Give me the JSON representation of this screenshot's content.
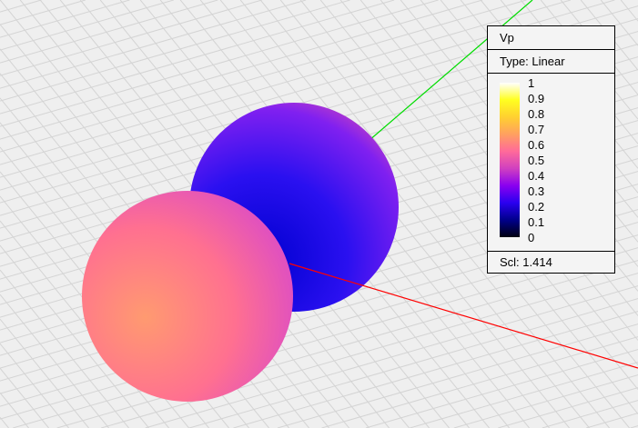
{
  "legend": {
    "title": "Vp",
    "type_label": "Type: Linear",
    "ticks": [
      "1",
      "0.9",
      "0.8",
      "0.7",
      "0.6",
      "0.5",
      "0.4",
      "0.3",
      "0.2",
      "0.1",
      "0"
    ],
    "scale_label": "Scl: 1.414",
    "colormap": [
      "#000010",
      "#00008a",
      "#2a00f0",
      "#8a00f0",
      "#d040c0",
      "#ff6a9a",
      "#ffa060",
      "#ffd030",
      "#ffff20",
      "#ffffff"
    ]
  },
  "axes": {
    "x_color": "#ff0000",
    "y_color": "#00dd00"
  }
}
